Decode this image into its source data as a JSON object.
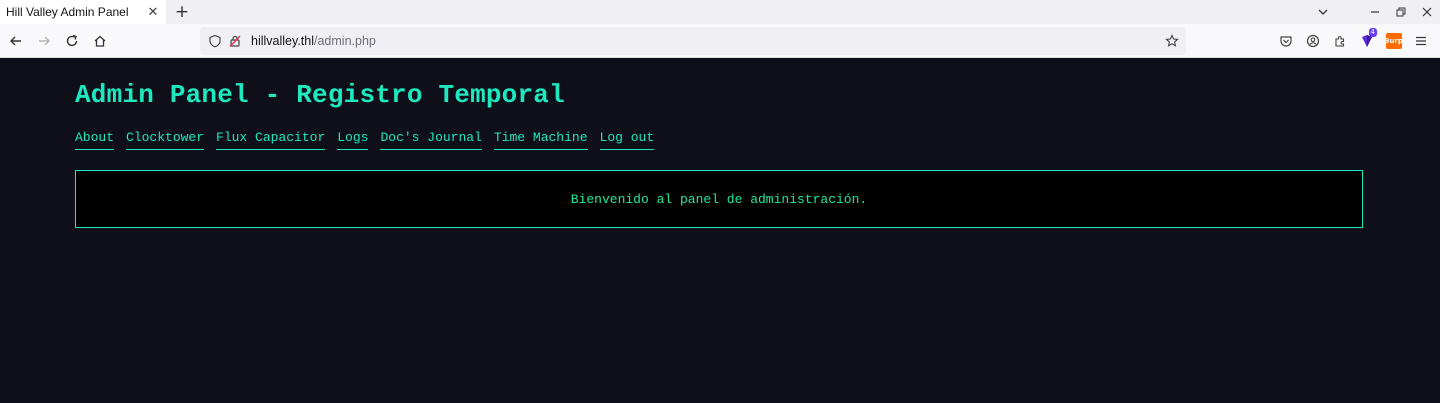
{
  "browser": {
    "tab_title": "Hill Valley Admin Panel",
    "url_host": "hillvalley.thl",
    "url_path": "/admin.php",
    "extension_badge": "4",
    "burp_label": "Burp"
  },
  "page": {
    "title": "Admin Panel - Registro Temporal",
    "nav": [
      {
        "label": "About"
      },
      {
        "label": "Clocktower"
      },
      {
        "label": "Flux Capacitor"
      },
      {
        "label": "Logs"
      },
      {
        "label": "Doc's Journal"
      },
      {
        "label": "Time Machine"
      },
      {
        "label": "Log out"
      }
    ],
    "welcome": "Bienvenido al panel de administración."
  },
  "colors": {
    "accent": "#1de8c0",
    "welcome_text": "#1ee89a",
    "background": "#0e0f18",
    "panel_bg": "#000000"
  }
}
